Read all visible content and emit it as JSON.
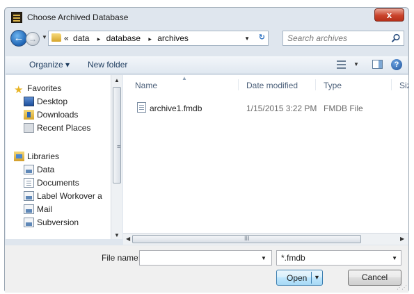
{
  "window": {
    "title": "Choose Archived Database",
    "close_label": "x"
  },
  "address": {
    "overflow": "«",
    "crumbs": [
      "data",
      "database",
      "archives"
    ],
    "separator": "▸",
    "refresh_glyph": "↻",
    "search_placeholder": "Search archives"
  },
  "toolbar": {
    "organize_label": "Organize ▾",
    "new_folder_label": "New folder",
    "help_label": "?"
  },
  "nav": {
    "favorites_label": "Favorites",
    "favorites": [
      "Desktop",
      "Downloads",
      "Recent Places"
    ],
    "libraries_label": "Libraries",
    "libraries": [
      "Data",
      "Documents",
      "Label Workover a",
      "Mail",
      "Subversion"
    ]
  },
  "columns": {
    "name": "Name",
    "date": "Date modified",
    "type": "Type",
    "size": "Size"
  },
  "files": [
    {
      "name": "archive1.fmdb",
      "date": "1/15/2015 3:22 PM",
      "type": "FMDB File"
    }
  ],
  "bottom": {
    "file_name_label": "File name:",
    "file_name_value": "",
    "filter_value": "*.fmdb",
    "open_label": "Open",
    "cancel_label": "Cancel"
  },
  "icons": {
    "star": "★",
    "chevron_down": "▼",
    "arrow_up": "▲",
    "arrow_left": "◀",
    "arrow_right": "▶",
    "grip": "≡",
    "hgrip": "III"
  }
}
